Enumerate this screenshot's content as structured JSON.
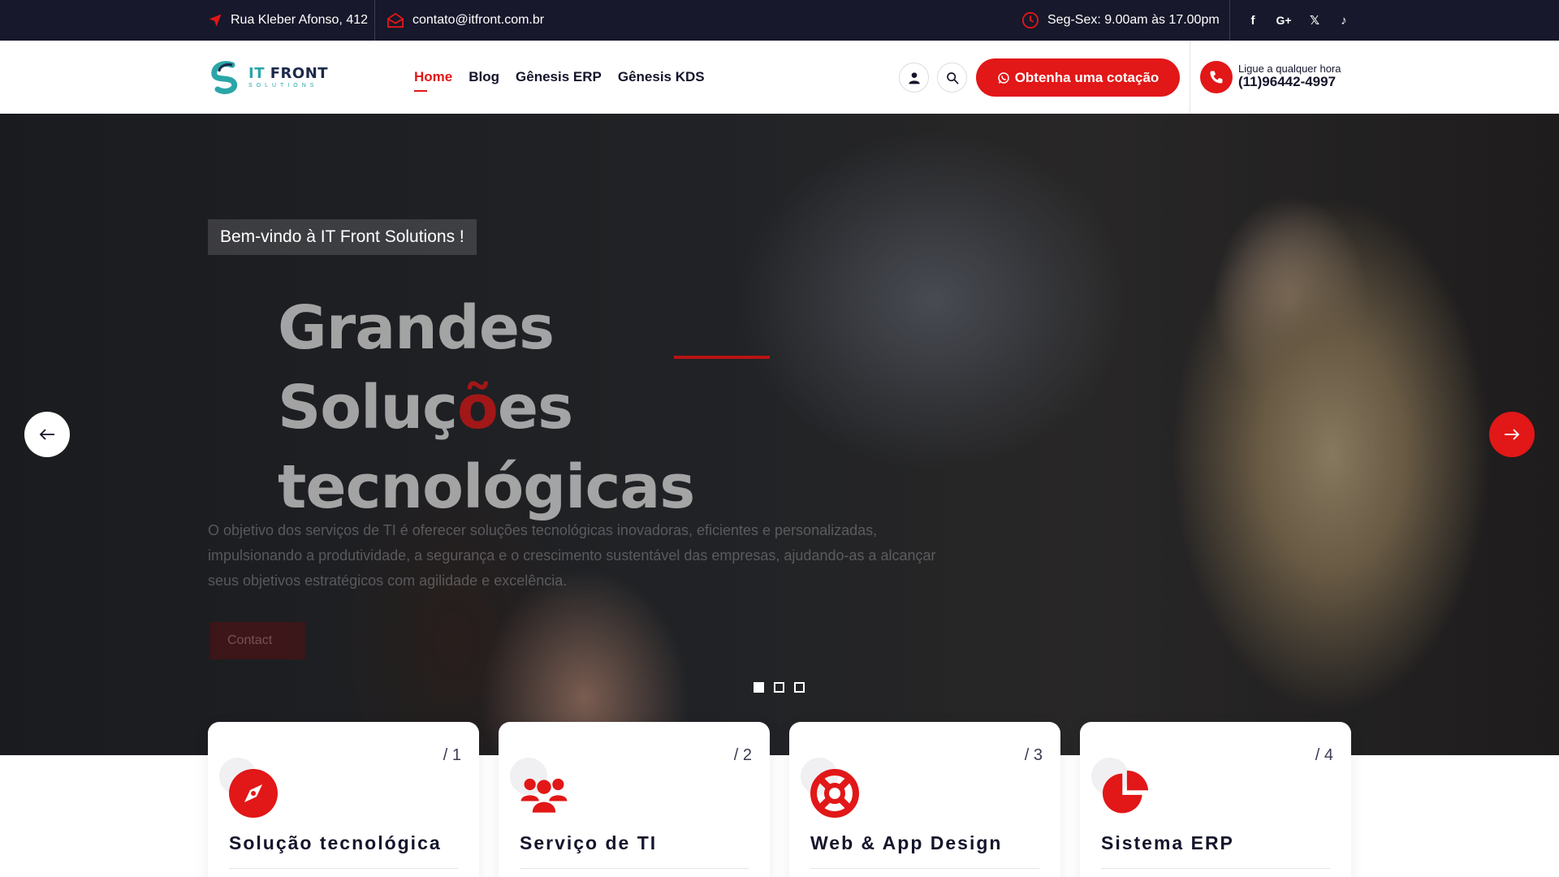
{
  "topbar": {
    "address": "Rua Kleber Afonso, 412",
    "email": "contato@itfront.com.br",
    "hours": "Seg-Sex: 9.00am às 17.00pm",
    "social": [
      {
        "icon": "facebook-icon",
        "glyph": "f"
      },
      {
        "icon": "google-plus-icon",
        "glyph": "G+"
      },
      {
        "icon": "x-twitter-icon",
        "glyph": "𝕏"
      },
      {
        "icon": "tiktok-icon",
        "glyph": "♪"
      }
    ]
  },
  "header": {
    "logo": {
      "it": "IT",
      "front": "FRONT",
      "sub": "SOLUTIONS"
    },
    "nav": [
      "Home",
      "Blog",
      "Gênesis ERP",
      "Gênesis KDS"
    ],
    "active_nav": "Home",
    "cta_label": "Obtenha uma cotação",
    "phone_small": "Ligue a qualquer hora",
    "phone_number": "(11)96442-4997"
  },
  "hero": {
    "welcome": "Bem-vindo à IT Front Solutions !",
    "title_line1_a": "Grandes Soluç",
    "title_line1_hl": "õ",
    "title_line1_b": "es",
    "title_line2": "tecnológicas",
    "description": "O objetivo dos serviços de TI é oferecer soluções tecnológicas inovadoras, eficientes e personalizadas, impulsionando a produtividade, a segurança e o crescimento sustentável das empresas, ajudando-as a alcançar seus objetivos estratégicos com agilidade e excelência.",
    "button_label": "Contact",
    "slides_total": 3,
    "active_slide": 1
  },
  "cards": [
    {
      "number": "/ 1",
      "title": "Solução tecnológica",
      "icon": "compass-icon"
    },
    {
      "number": "/ 2",
      "title": "Serviço de TI",
      "icon": "users-icon"
    },
    {
      "number": "/ 3",
      "title": "Web & App Design",
      "icon": "lifebuoy-icon"
    },
    {
      "number": "/ 4",
      "title": "Sistema ERP",
      "icon": "pie-chart-icon"
    }
  ],
  "colors": {
    "accent": "#e21717",
    "dark": "#17182b",
    "teal": "#2aa6a8"
  }
}
